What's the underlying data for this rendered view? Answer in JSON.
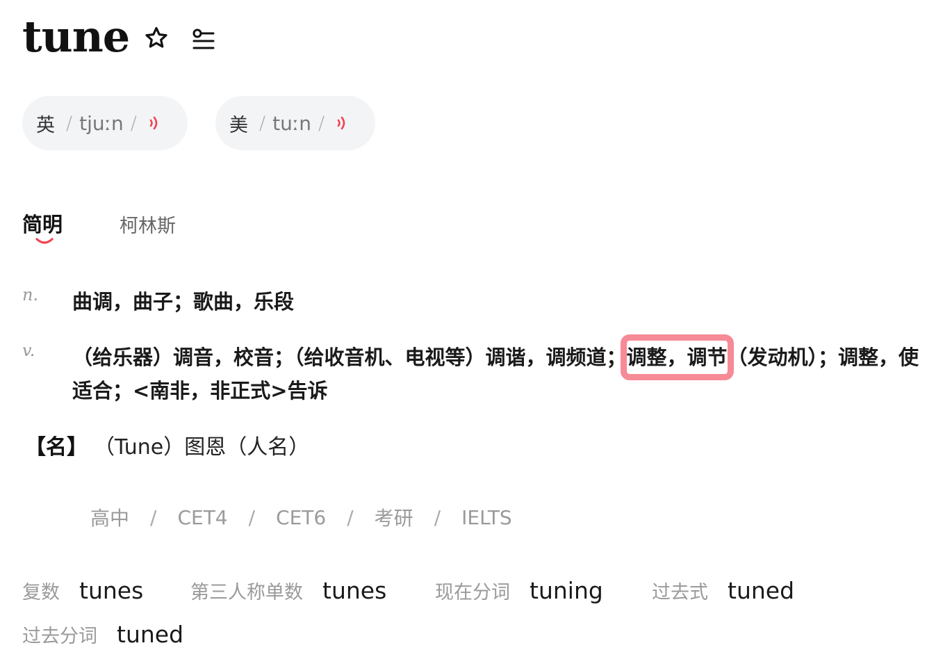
{
  "header": {
    "word": "tune",
    "star_icon": "star-icon",
    "wordlist_icon": "wordlist-icon"
  },
  "pronunciations": [
    {
      "region": "英",
      "ipa": "tjuːn",
      "speaker_icon": "speaker-icon",
      "speaker_color": "#f0424f"
    },
    {
      "region": "美",
      "ipa": "tuːn",
      "speaker_icon": "speaker-icon",
      "speaker_color": "#f0424f"
    }
  ],
  "tabs": [
    {
      "label": "简明",
      "active": true
    },
    {
      "label": "柯林斯",
      "active": false
    }
  ],
  "accent_color": "#f0424f",
  "definitions": [
    {
      "pos": "n.",
      "text": "曲调，曲子；歌曲，乐段"
    },
    {
      "pos": "v.",
      "text_before": "（给乐器）调音，校音；（给收音机、电视等）调谐，调频道；",
      "text_highlight": "调整，调节",
      "text_after": "（发动机）；调整，使适合；<南非，非正式>告诉"
    }
  ],
  "highlight_color": "#f68a96",
  "name_entry": {
    "tag": "【名】",
    "text": "（Tune）图恩（人名）"
  },
  "exam_tags": [
    "高中",
    "CET4",
    "CET6",
    "考研",
    "IELTS"
  ],
  "exam_separator": "/",
  "inflections": [
    {
      "label": "复数",
      "form": "tunes"
    },
    {
      "label": "第三人称单数",
      "form": "tunes"
    },
    {
      "label": "现在分词",
      "form": "tuning"
    },
    {
      "label": "过去式",
      "form": "tuned"
    },
    {
      "label": "过去分词",
      "form": "tuned"
    }
  ]
}
